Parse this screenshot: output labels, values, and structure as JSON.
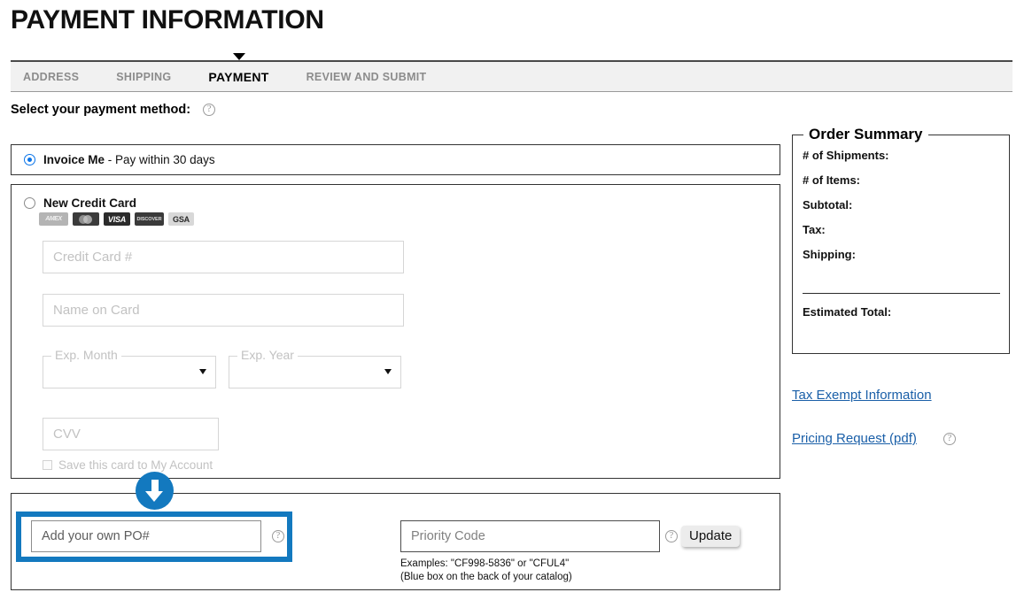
{
  "page": {
    "title": "PAYMENT INFORMATION"
  },
  "tabs": [
    {
      "label": "ADDRESS",
      "active": false
    },
    {
      "label": "SHIPPING",
      "active": false
    },
    {
      "label": "PAYMENT",
      "active": true
    },
    {
      "label": "REVIEW AND SUBMIT",
      "active": false
    }
  ],
  "select_method": {
    "label": "Select your payment method:",
    "help_icon": "help-circle-icon"
  },
  "payment_methods": {
    "invoice": {
      "label_bold": "Invoice Me",
      "label_rest": "- Pay within 30 days",
      "selected": true
    },
    "credit_card": {
      "label": "New Credit Card",
      "selected": false,
      "accepted_cards": [
        {
          "name": "amex-logo",
          "text": "AMEX"
        },
        {
          "name": "mastercard-logo",
          "text": ""
        },
        {
          "name": "visa-logo",
          "text": "VISA"
        },
        {
          "name": "discover-logo",
          "text": "DISCOVER"
        },
        {
          "name": "gsa-logo",
          "text": "GSA"
        }
      ],
      "fields": {
        "card_number_placeholder": "Credit Card #",
        "name_on_card_placeholder": "Name on Card",
        "exp_month_label": "Exp. Month",
        "exp_month_value": "",
        "exp_year_label": "Exp. Year",
        "exp_year_value": "",
        "cvv_placeholder": "CVV",
        "save_card_label": "Save this card to My Account",
        "save_card_checked": false
      }
    }
  },
  "po_section": {
    "po_placeholder": "Add your own PO#",
    "po_help_icon": "help-circle-icon",
    "priority_placeholder": "Priority Code",
    "priority_help_icon": "help-circle-icon",
    "update_label": "Update",
    "examples_line1": "Examples: \"CF998-5836\" or \"CFUL4\"",
    "examples_line2": "(Blue box on the back of your catalog)",
    "highlight_color": "#1379bf",
    "annotation_icon": "down-arrow-icon"
  },
  "order_summary": {
    "title": "Order Summary",
    "rows": [
      {
        "label": "# of Shipments:",
        "value": ""
      },
      {
        "label": "# of Items:",
        "value": ""
      },
      {
        "label": "Subtotal:",
        "value": ""
      },
      {
        "label": "Tax:",
        "value": ""
      },
      {
        "label": "Shipping:",
        "value": ""
      }
    ],
    "total": {
      "label": "Estimated Total:",
      "value": ""
    }
  },
  "side_links": {
    "tax_exempt": "Tax Exempt Information",
    "pricing_request": "Pricing Request (pdf)",
    "pricing_help_icon": "help-circle-icon",
    "link_color": "#1a5fa8"
  }
}
